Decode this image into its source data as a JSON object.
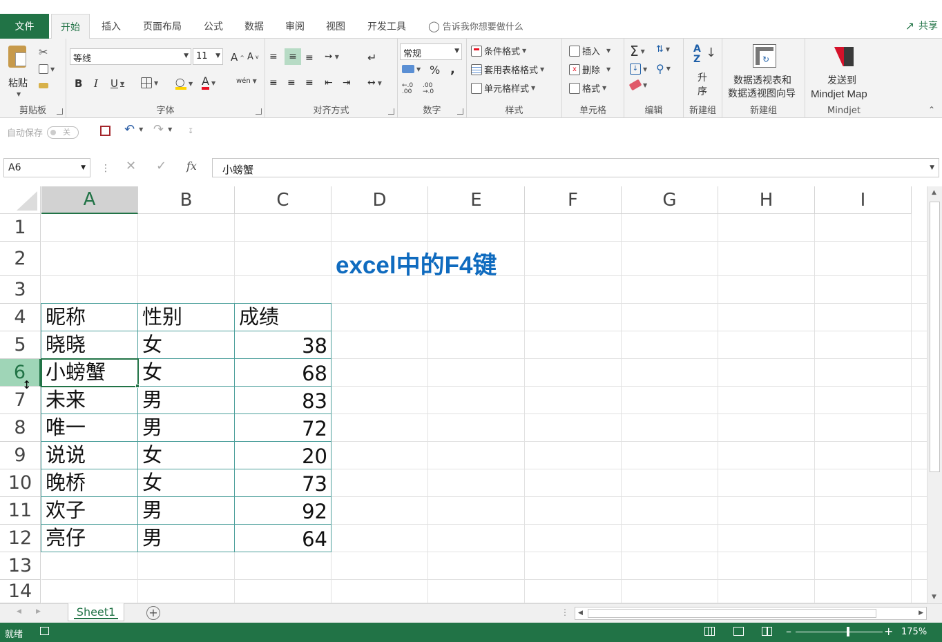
{
  "tabs": {
    "file": "文件",
    "items": [
      "开始",
      "插入",
      "页面布局",
      "公式",
      "数据",
      "审阅",
      "视图",
      "开发工具"
    ],
    "tell_me": "告诉我你想要做什么",
    "share": "共享"
  },
  "ribbon": {
    "clipboard": {
      "paste": "粘贴",
      "label": "剪贴板"
    },
    "font": {
      "name": "等线",
      "size": "11",
      "label": "字体",
      "bold": "B",
      "italic": "I",
      "underline": "U",
      "grow": "A",
      "shrink": "A",
      "color_letter": "A",
      "wen": "wén"
    },
    "alignment": {
      "label": "对齐方式"
    },
    "number": {
      "format": "常规",
      "percent": "%",
      "comma": ",",
      "label": "数字"
    },
    "styles": {
      "conditional": "条件格式",
      "table": "套用表格格式",
      "cell_styles": "单元格样式",
      "label": "样式"
    },
    "cells": {
      "insert": "插入",
      "delete": "删除",
      "format": "格式",
      "label": "单元格"
    },
    "editing": {
      "label": "编辑"
    },
    "sort": {
      "line1": "升",
      "line2": "序",
      "label": "新建组"
    },
    "pivot": {
      "line1": "数据透视表和",
      "line2": "数据透视图向导",
      "label": "新建组"
    },
    "mindjet": {
      "line1": "发送到",
      "line2": "Mindjet Map",
      "label": "Mindjet"
    }
  },
  "qat": {
    "autosave": "自动保存",
    "toggle": "关"
  },
  "formula_bar": {
    "name_box": "A6",
    "content": "小螃蟹",
    "fx": "fx"
  },
  "grid": {
    "columns": [
      "A",
      "B",
      "C",
      "D",
      "E",
      "F",
      "G",
      "H",
      "I"
    ],
    "rows": [
      "1",
      "2",
      "3",
      "4",
      "5",
      "6",
      "7",
      "8",
      "9",
      "10",
      "11",
      "12",
      "13",
      "14"
    ],
    "selected_column": "A",
    "selected_row": "6",
    "title": "excel中的F4键",
    "table": {
      "headers": [
        "昵称",
        "性别",
        "成绩"
      ],
      "rows": [
        [
          "晓晓",
          "女",
          "38"
        ],
        [
          "小螃蟹",
          "女",
          "68"
        ],
        [
          "未来",
          "男",
          "83"
        ],
        [
          "唯一",
          "男",
          "72"
        ],
        [
          "说说",
          "女",
          "20"
        ],
        [
          "晚桥",
          "女",
          "73"
        ],
        [
          "欢子",
          "男",
          "92"
        ],
        [
          "亮仔",
          "男",
          "64"
        ]
      ]
    }
  },
  "sheets": {
    "active": "Sheet1",
    "add": "+"
  },
  "status": {
    "ready": "就绪",
    "zoom": "175%"
  },
  "colors": {
    "accent": "#217346",
    "title": "#0f6bbf",
    "table_border": "#4a9e9a"
  }
}
